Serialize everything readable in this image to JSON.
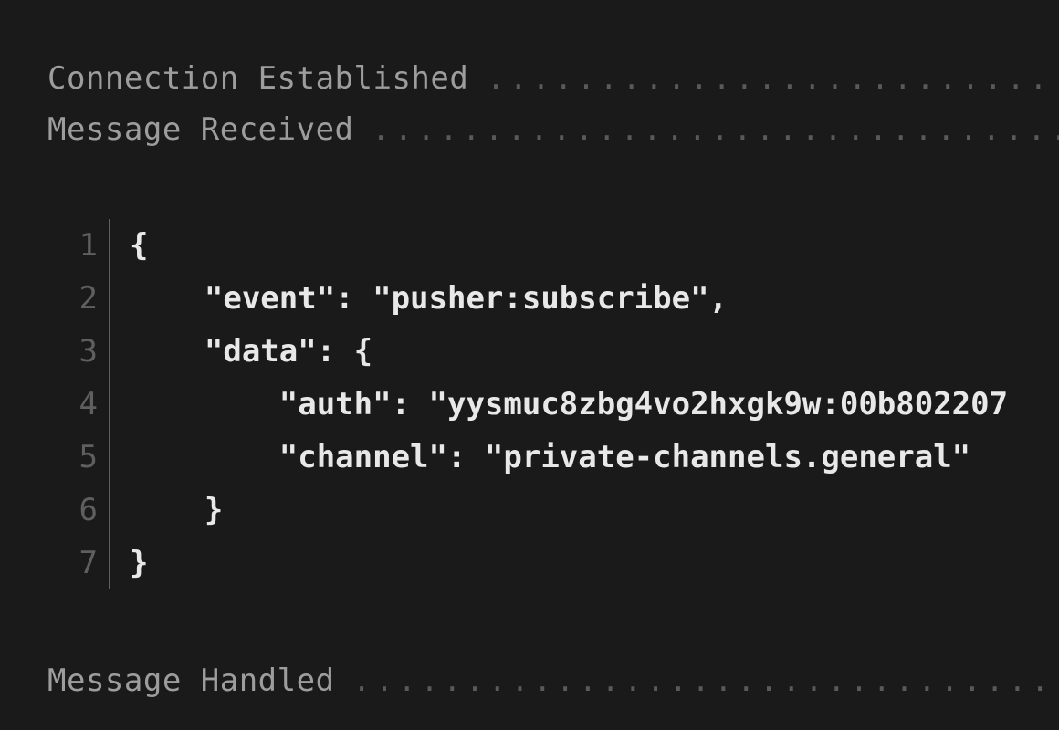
{
  "log": {
    "connection_established": "Connection Established",
    "message_received": "Message Received",
    "message_handled": "Message Handled",
    "dots": "........................................................"
  },
  "code": {
    "lines": [
      {
        "n": "1",
        "text": "{"
      },
      {
        "n": "2",
        "text": "    \"event\": \"pusher:subscribe\","
      },
      {
        "n": "3",
        "text": "    \"data\": {"
      },
      {
        "n": "4",
        "text": "        \"auth\": \"yysmuc8zbg4vo2hxgk9w:00b802207"
      },
      {
        "n": "5",
        "text": "        \"channel\": \"private-channels.general\""
      },
      {
        "n": "6",
        "text": "    }"
      },
      {
        "n": "7",
        "text": "}"
      }
    ]
  }
}
